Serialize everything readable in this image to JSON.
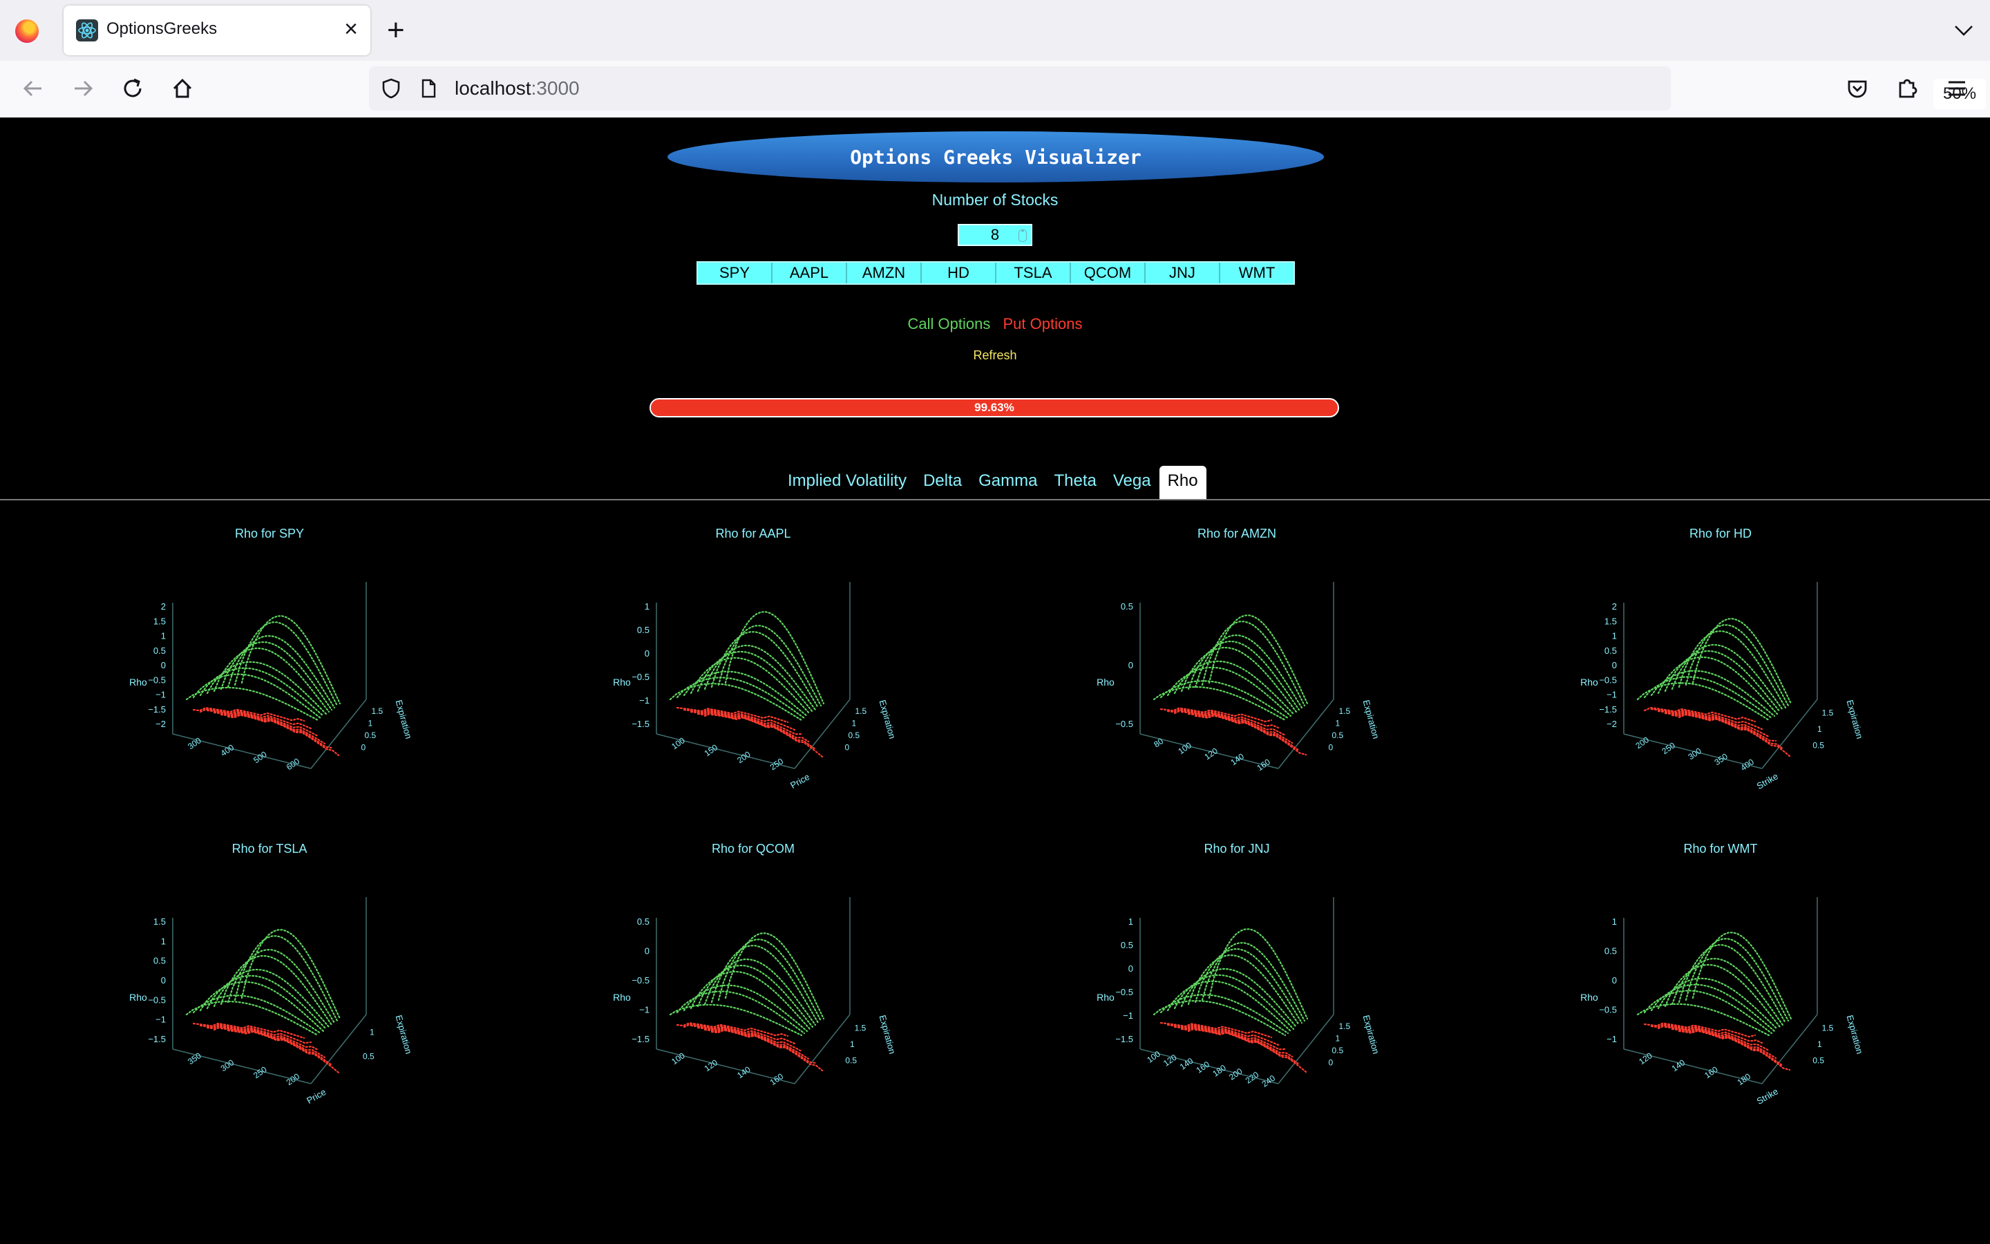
{
  "browser": {
    "tab_title": "OptionsGreeks",
    "url_host": "localhost",
    "url_port": ":3000",
    "zoom": "50%"
  },
  "app": {
    "title": "Options Greeks Visualizer",
    "num_stocks_label": "Number of Stocks",
    "num_stocks_value": "8",
    "tickers": [
      "SPY",
      "AAPL",
      "AMZN",
      "HD",
      "TSLA",
      "QCOM",
      "JNJ",
      "WMT"
    ],
    "call_label": "Call Options",
    "put_label": "Put Options",
    "refresh_label": "Refresh",
    "progress_text": "99.63%",
    "progress_fraction": 0.9963,
    "tabs": [
      "Implied Volatility",
      "Delta",
      "Gamma",
      "Theta",
      "Vega",
      "Rho"
    ],
    "active_tab": "Rho"
  },
  "colors": {
    "call": "#5fd35f",
    "put": "#ff3b2f",
    "accent": "#8af2ff",
    "ticker_bg": "#66ffff",
    "progress": "#ee3524"
  },
  "chart_data": [
    {
      "type": "scatter",
      "title": "Rho for SPY",
      "zlabel": "Rho",
      "ylabel": "Expiration",
      "ztick_labels": [
        "2",
        "1.5",
        "1",
        "0.5",
        "0",
        "−0.5",
        "−1",
        "−1.5",
        "−2"
      ],
      "xtick_labels": [
        "300",
        "400",
        "500",
        "600"
      ],
      "ytick_labels": [
        "1.5",
        "1",
        "0.5",
        "0"
      ]
    },
    {
      "type": "scatter",
      "title": "Rho for AAPL",
      "zlabel": "Rho",
      "ylabel": "Expiration",
      "xlabel": "Price",
      "ztick_labels": [
        "1",
        "0.5",
        "0",
        "−0.5",
        "−1",
        "−1.5"
      ],
      "ytick_labels": [
        "1.5",
        "1",
        "0.5",
        "0"
      ],
      "xtick_labels": [
        "100",
        "150",
        "200",
        "250"
      ]
    },
    {
      "type": "scatter",
      "title": "Rho for AMZN",
      "zlabel": "Rho",
      "ylabel": "Expiration",
      "ztick_labels": [
        "0.5",
        "0",
        "−0.5"
      ],
      "xtick_labels": [
        "80",
        "100",
        "120",
        "140",
        "160"
      ],
      "ytick_labels": [
        "1.5",
        "1",
        "0.5",
        "0"
      ]
    },
    {
      "type": "scatter",
      "title": "Rho for HD",
      "zlabel": "Rho",
      "ylabel": "Expiration",
      "xlabel": "Strike",
      "ztick_labels": [
        "2",
        "1.5",
        "1",
        "0.5",
        "0",
        "−0.5",
        "−1",
        "−1.5",
        "−2"
      ],
      "xtick_labels": [
        "200",
        "250",
        "300",
        "350",
        "400"
      ],
      "ytick_labels": [
        "1.5",
        "1",
        "0.5"
      ]
    },
    {
      "type": "scatter",
      "title": "Rho for TSLA",
      "zlabel": "Rho",
      "ylabel": "Expiration",
      "xlabel": "Price",
      "ztick_labels": [
        "1.5",
        "1",
        "0.5",
        "0",
        "−0.5",
        "−1",
        "−1.5"
      ],
      "ytick_labels": [
        "1",
        "0.5"
      ],
      "xtick_labels": [
        "350",
        "300",
        "250",
        "200"
      ]
    },
    {
      "type": "scatter",
      "title": "Rho for QCOM",
      "zlabel": "Rho",
      "ylabel": "Expiration",
      "ztick_labels": [
        "0.5",
        "0",
        "−0.5",
        "−1",
        "−1.5"
      ],
      "ytick_labels": [
        "1.5",
        "1",
        "0.5"
      ],
      "xtick_labels": [
        "100",
        "120",
        "140",
        "160"
      ]
    },
    {
      "type": "scatter",
      "title": "Rho for JNJ",
      "zlabel": "Rho",
      "ylabel": "Expiration",
      "ztick_labels": [
        "1",
        "0.5",
        "0",
        "−0.5",
        "−1",
        "−1.5"
      ],
      "ytick_labels": [
        "1.5",
        "1",
        "0.5",
        "0"
      ],
      "xtick_labels": [
        "100",
        "120",
        "140",
        "160",
        "180",
        "200",
        "220",
        "240"
      ]
    },
    {
      "type": "scatter",
      "title": "Rho for WMT",
      "zlabel": "Rho",
      "ylabel": "Expiration",
      "xlabel": "Strike",
      "ztick_labels": [
        "1",
        "0.5",
        "0",
        "−0.5",
        "−1"
      ],
      "xtick_labels": [
        "120",
        "140",
        "160",
        "180"
      ],
      "ytick_labels": [
        "1.5",
        "1",
        "0.5"
      ]
    }
  ]
}
